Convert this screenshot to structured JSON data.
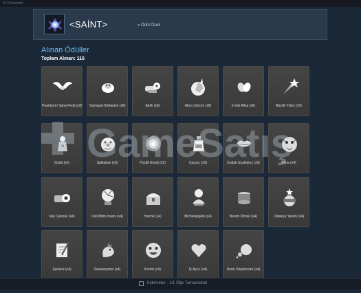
{
  "browser": {
    "url": "6179/awards/"
  },
  "profile": {
    "name": "<SAİNT>",
    "breadcrumb": "» Ödül Özeti",
    "accent": "#66c0f4"
  },
  "awards": {
    "title": "Alınan Ödüller",
    "total_label": "Toplam Alınan: 116",
    "items": [
      {
        "label": "Puanlarım Sana Feda (x8)",
        "icon": "wings-icon"
      },
      {
        "label": "Yumuşak Battaniye (x8)",
        "icon": "blanket-icon"
      },
      {
        "label": "Akıllı (x8)",
        "icon": "brain-gear-icon"
      },
      {
        "label": "Altın Unicorn (x8)",
        "icon": "unicorn-icon"
      },
      {
        "label": "İronik Alkış (x6)",
        "icon": "clapping-hands-icon"
      },
      {
        "label": "Büyük Yıldız (x5)",
        "icon": "shooting-star-icon"
      },
      {
        "label": "Süslü (x5)",
        "icon": "fancy-figure-icon"
      },
      {
        "label": "Şaklaban (x5)",
        "icon": "clown-icon"
      },
      {
        "label": "Pozitif Enerji (x5)",
        "icon": "energy-orb-icon"
      },
      {
        "label": "Çarpıcı (x5)",
        "icon": "potion-bottle-icon"
      },
      {
        "label": "Dudak Uçuklatıcı (x5)",
        "icon": "lips-icon"
      },
      {
        "label": "Fena (x4)",
        "icon": "tiger-icon"
      },
      {
        "label": "Vay Canına! (x4)",
        "icon": "eyeballs-icon"
      },
      {
        "label": "Deli Bilim İnsanı (x4)",
        "icon": "plasma-globe-icon"
      },
      {
        "label": "Hazine (x4)",
        "icon": "treasure-chest-icon"
      },
      {
        "label": "Michelangelo (x4)",
        "icon": "bust-icon"
      },
      {
        "label": "Benim Olmalı (x4)",
        "icon": "pedestal-icon"
      },
      {
        "label": "Oldukça Yararlı (x4)",
        "icon": "mask-icon"
      },
      {
        "label": "Şairane (x4)",
        "icon": "scroll-quill-icon"
      },
      {
        "label": "Sansasyonel (x4)",
        "icon": "rooster-icon"
      },
      {
        "label": "Komik (x4)",
        "icon": "laughing-face-icon"
      },
      {
        "label": "İç Açıcı (x4)",
        "icon": "heart-icon"
      },
      {
        "label": "Derin Düşünceler (x4)",
        "icon": "thought-bubble-icon"
      }
    ]
  },
  "watermark": {
    "text": "GameSatış"
  },
  "statusbar": {
    "text": "İndirmeler - 1/1 Öğe Tamamlandı"
  }
}
